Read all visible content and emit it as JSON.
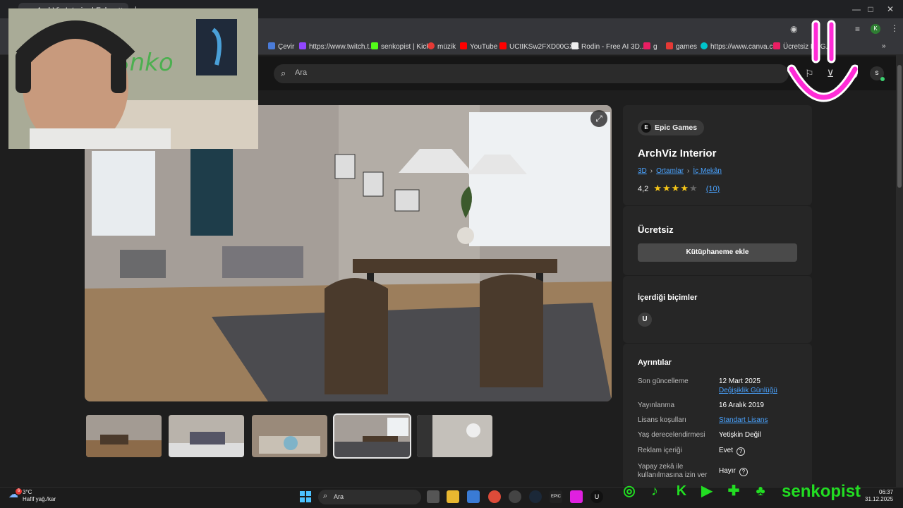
{
  "browser": {
    "tab_title": "ArchViz Interior | Fab",
    "tab_close": "×",
    "new_tab": "+",
    "window_buttons": [
      "—",
      "□",
      "✕"
    ],
    "bookmarks": [
      {
        "label": "Çevir",
        "color": "#4a7bd8"
      },
      {
        "label": "https://www.twitch.t...",
        "color": "#9146ff"
      },
      {
        "label": "senkopist | Kick",
        "color": "#53fc18"
      },
      {
        "label": "müzik",
        "color": "#e53935"
      },
      {
        "label": "YouTube",
        "color": "#ff0000"
      },
      {
        "label": "UCtIKSw2FXD00GX...",
        "color": "#ff0000"
      },
      {
        "label": "Rodin - Free AI 3D...",
        "color": "#eeeeee"
      },
      {
        "label": "g",
        "color": "#e91e63"
      },
      {
        "label": "games",
        "color": "#e53935"
      },
      {
        "label": "https://www.canva.c...",
        "color": "#00c4cc"
      },
      {
        "label": "Ücretsiz PNG...",
        "color": "#e91e63"
      }
    ],
    "profile_initial": "K",
    "bookmarks_more": "»"
  },
  "header": {
    "search_placeholder": "Ara",
    "avatar_initial": "s"
  },
  "product": {
    "publisher": "Epic Games",
    "title": "ArchViz Interior",
    "breadcrumb": [
      "3D",
      "Ortamlar",
      "İç Mekân"
    ],
    "rating_value": "4,2",
    "rating_stars": 4.2,
    "rating_count": "(10)",
    "price": "Ücretsiz",
    "add_button": "Kütüphaneme ekle",
    "formats_heading": "İçerdiği biçimler",
    "format_icon": "U",
    "details_heading": "Ayrıntılar",
    "details": [
      {
        "label": "Son güncelleme",
        "value": "12 Mart 2025",
        "sub_link": "Değişiklik Günlüğü"
      },
      {
        "label": "Yayınlanma",
        "value": "16 Aralık 2019"
      },
      {
        "label": "Lisans koşulları",
        "value": "Standart Lisans",
        "link": true
      },
      {
        "label": "Yaş derecelendirmesi",
        "value": "Yetişkin Değil"
      },
      {
        "label": "Reklam içeriği",
        "value": "Evet",
        "help": "?"
      },
      {
        "label": "Yapay zekâ ile kullanılmasına izin ver",
        "value": "Hayır",
        "help": "?"
      }
    ],
    "thumbnail_count": 5,
    "active_thumbnail": 4
  },
  "taskbar": {
    "temperature": "3°C",
    "weather": "Hafif yağ./kar",
    "weather_badge": "6",
    "search": "Ara",
    "time": "06:37",
    "date": "31.12.2025",
    "apps": [
      {
        "name": "explorer",
        "color": "#e8b730"
      },
      {
        "name": "store",
        "color": "#3a7bd5"
      },
      {
        "name": "chrome",
        "color": "#dd4b39"
      },
      {
        "name": "obs",
        "color": "#444"
      },
      {
        "name": "steam",
        "color": "#1b2838"
      },
      {
        "name": "epic",
        "label": "EPIC",
        "color": "#222"
      },
      {
        "name": "app-pink",
        "color": "#e020e0"
      },
      {
        "name": "unreal",
        "label": "U",
        "color": "#111"
      }
    ]
  },
  "overlay": {
    "streamer_name": "senkopist",
    "social_icons": [
      "instagram-icon",
      "tiktok-icon",
      "kick-icon",
      "youtube-icon",
      "like-icon",
      "bell-icon"
    ],
    "smile_color": "#ff2bd6"
  }
}
